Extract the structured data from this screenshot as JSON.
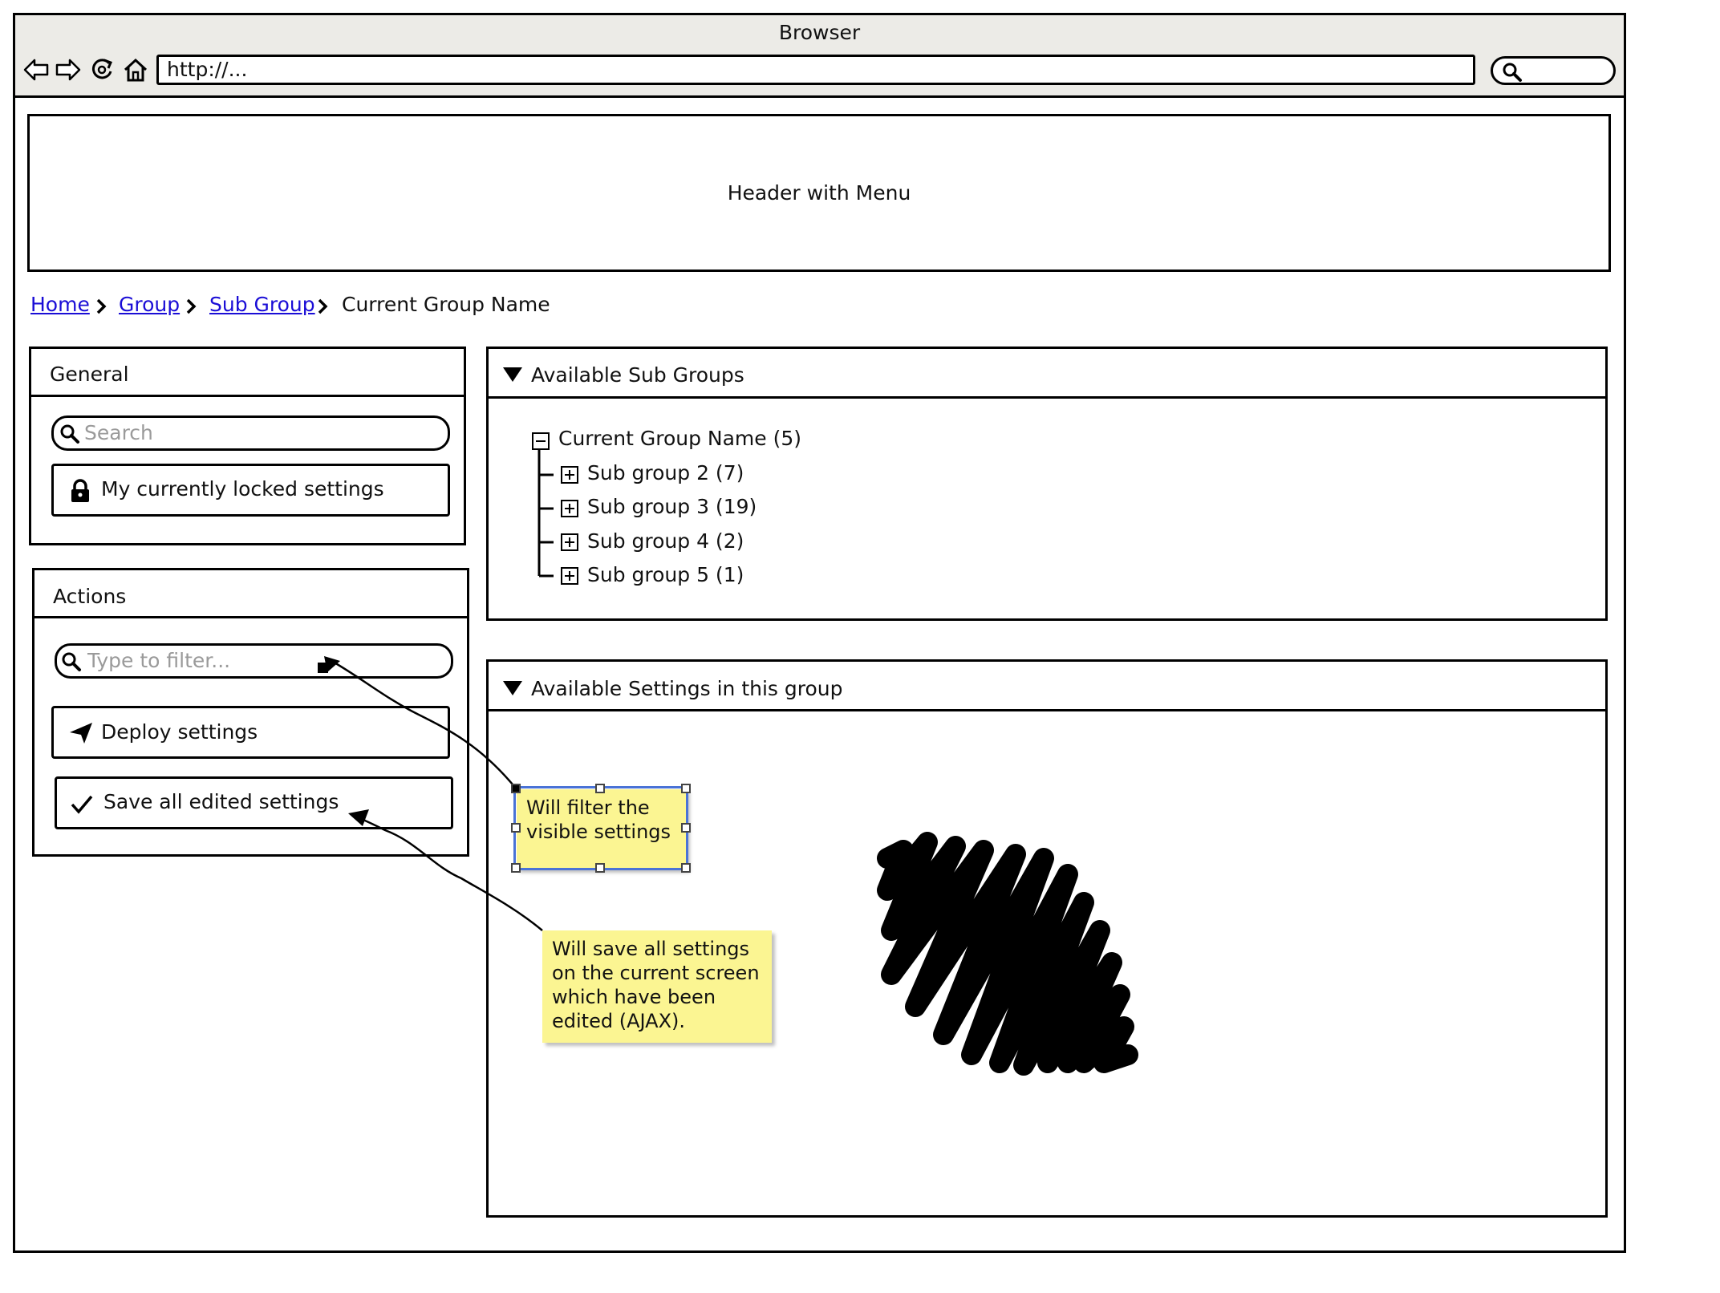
{
  "browser": {
    "title": "Browser",
    "url": "http://..."
  },
  "header": {
    "label": "Header with Menu"
  },
  "breadcrumb": {
    "items": [
      {
        "label": "Home",
        "link": true
      },
      {
        "label": "Group",
        "link": true
      },
      {
        "label": "Sub Group",
        "link": true
      },
      {
        "label": "Current Group Name",
        "link": false
      }
    ]
  },
  "general": {
    "title": "General",
    "search_placeholder": "Search",
    "locked_button": "My currently locked settings"
  },
  "actions": {
    "title": "Actions",
    "filter_placeholder": "Type to filter...",
    "deploy_button": "Deploy settings",
    "save_button": "Save all edited settings"
  },
  "subgroups": {
    "title": "Available Sub Groups",
    "root": "Current Group Name (5)",
    "children": [
      "Sub group 2 (7)",
      "Sub group 3 (19)",
      "Sub group 4 (2)",
      "Sub group 5 (1)"
    ]
  },
  "settings": {
    "title": "Available Settings in this group"
  },
  "notes": {
    "filter": [
      "Will filter the",
      "visible settings"
    ],
    "save": [
      "Will save all settings",
      "on the current screen",
      "which have been",
      "edited (AJAX)."
    ]
  },
  "colors": {
    "link": "#1a0dd6",
    "note": "#fbf592",
    "chrome": "#ecebe7",
    "selection": "#4a73d6"
  },
  "icons": [
    "back-arrow-icon",
    "forward-arrow-icon",
    "reload-icon",
    "home-icon",
    "search-icon",
    "lock-icon",
    "chevron-right-icon",
    "triangle-down-icon",
    "tree-collapse-icon",
    "tree-expand-icon",
    "send-icon",
    "checkmark-icon",
    "scribble-placeholder"
  ]
}
